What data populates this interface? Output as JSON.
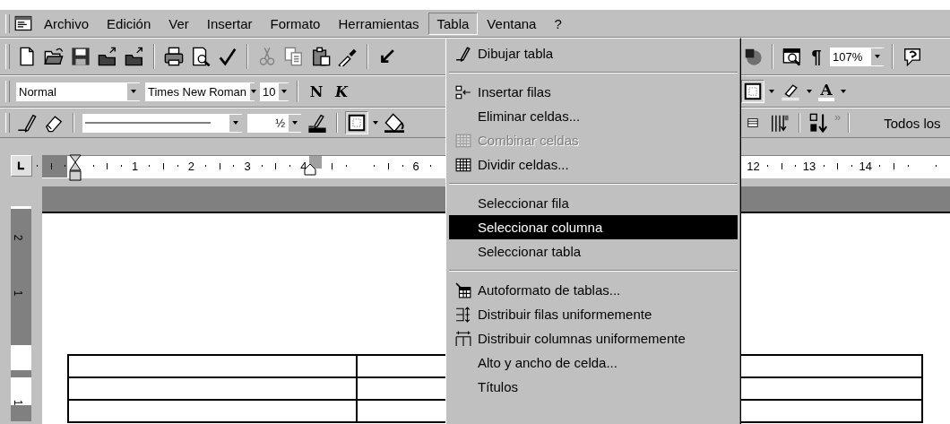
{
  "menu_bar": [
    {
      "label": "Archivo",
      "selected": false
    },
    {
      "label": "Edición",
      "selected": false
    },
    {
      "label": "Ver",
      "selected": false
    },
    {
      "label": "Insertar",
      "selected": false
    },
    {
      "label": "Formato",
      "selected": false
    },
    {
      "label": "Herramientas",
      "selected": false
    },
    {
      "label": "Tabla",
      "selected": true
    },
    {
      "label": "Ventana",
      "selected": false
    },
    {
      "label": "?",
      "selected": false
    }
  ],
  "standard_toolbar": {
    "pilcrow": "¶",
    "zoom": "107%"
  },
  "formatting_toolbar": {
    "style": "Normal",
    "font": "Times New Roman",
    "size": "10",
    "bold": "N",
    "italic": "K",
    "font_color": "A"
  },
  "tables_toolbar": {
    "line_weight": "½",
    "more": "»",
    "style_box": "Todos los"
  },
  "ruler": {
    "labels": [
      "1",
      "2",
      "3",
      "4",
      "6",
      "12",
      "13",
      "14"
    ]
  },
  "vertical_ruler": {
    "labels": [
      "2",
      "1",
      "1"
    ]
  },
  "table_menu": {
    "items": [
      {
        "kind": "item",
        "label": "Dibujar tabla",
        "disabled": false,
        "selected": false
      },
      {
        "kind": "separator"
      },
      {
        "kind": "item",
        "label": "Insertar filas",
        "disabled": false,
        "selected": false
      },
      {
        "kind": "item",
        "label": "Eliminar celdas...",
        "disabled": false,
        "selected": false
      },
      {
        "kind": "item",
        "label": "Combinar celdas",
        "disabled": true,
        "selected": false
      },
      {
        "kind": "item",
        "label": "Dividir celdas...",
        "disabled": false,
        "selected": false
      },
      {
        "kind": "separator"
      },
      {
        "kind": "item",
        "label": "Seleccionar fila",
        "disabled": false,
        "selected": false
      },
      {
        "kind": "item",
        "label": "Seleccionar columna",
        "disabled": false,
        "selected": true
      },
      {
        "kind": "item",
        "label": "Seleccionar tabla",
        "disabled": false,
        "selected": false
      },
      {
        "kind": "separator"
      },
      {
        "kind": "item",
        "label": "Autoformato de tablas...",
        "disabled": false,
        "selected": false
      },
      {
        "kind": "item",
        "label": "Distribuir filas uniformemente",
        "disabled": false,
        "selected": false
      },
      {
        "kind": "item",
        "label": "Distribuir columnas uniformemente",
        "disabled": false,
        "selected": false
      },
      {
        "kind": "item",
        "label": "Alto y ancho de celda...",
        "disabled": false,
        "selected": false
      },
      {
        "kind": "item",
        "label": "Títulos",
        "disabled": false,
        "selected": false
      }
    ]
  }
}
